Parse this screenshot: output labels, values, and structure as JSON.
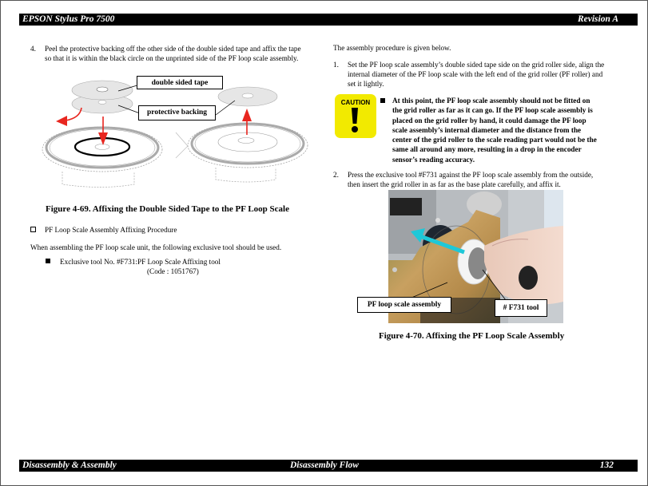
{
  "header": {
    "title": "EPSON Stylus Pro 7500",
    "revision": "Revision A"
  },
  "footer": {
    "section": "Disassembly & Assembly",
    "subsection": "Disassembly Flow",
    "page_number": "132"
  },
  "left_column": {
    "step4": {
      "number": "4.",
      "line1": "Peel the protective backing off the other side of the double sided tape and affix the tape",
      "line2": "so that it is within the black circle on the unprinted side of the PF loop scale assembly."
    },
    "figure_69": {
      "callout_tape": "double sided tape",
      "callout_backing": "protective backing",
      "caption": "Figure 4-69.  Affixing the Double Sided Tape to the PF Loop Scale"
    },
    "procedure_heading": "PF Loop Scale Assembly Affixing Procedure",
    "intro": "When assembling the PF loop scale unit, the following exclusive tool should be used.",
    "tool_item": {
      "line1": "Exclusive tool No. #F731:PF Loop Scale Affixing tool",
      "line2": "(Code : 1051767)"
    }
  },
  "right_column": {
    "intro": "The assembly procedure is given below.",
    "step1": {
      "number": "1.",
      "line1": "Set the PF loop scale assembly’s double sided tape side on the grid roller side, align the",
      "line2": "internal diameter of the PF loop scale with the left end of the grid roller (PF roller) and",
      "line3": "set it lightly."
    },
    "caution": {
      "label": "CAUTION",
      "lines": [
        "At this point, the PF loop scale assembly should not be fitted on",
        "the grid roller as far as it can go. If the PF loop scale assembly is",
        "placed on the grid roller by hand, it could damage the PF loop",
        "scale assembly’s internal diameter and the distance from the",
        "center of the grid roller to the scale reading part would not be the",
        "same all around any more, resulting in a drop in the encoder",
        "sensor’s reading accuracy."
      ]
    },
    "step2": {
      "number": "2.",
      "line1": "Press the exclusive tool #F731 against the PF loop scale assembly from the outside,",
      "line2": "then insert the grid roller in as far as the base plate carefully, and affix it."
    },
    "figure_70": {
      "callout_scale": "PF loop scale assembly",
      "callout_tool": "# F731 tool",
      "caption": "Figure 4-70.  Affixing the PF Loop Scale Assembly"
    }
  },
  "colors": {
    "arrow_red": "#e8261f",
    "arrow_cyan": "#1ec8d8",
    "caution_yellow": "#f2ea00"
  }
}
